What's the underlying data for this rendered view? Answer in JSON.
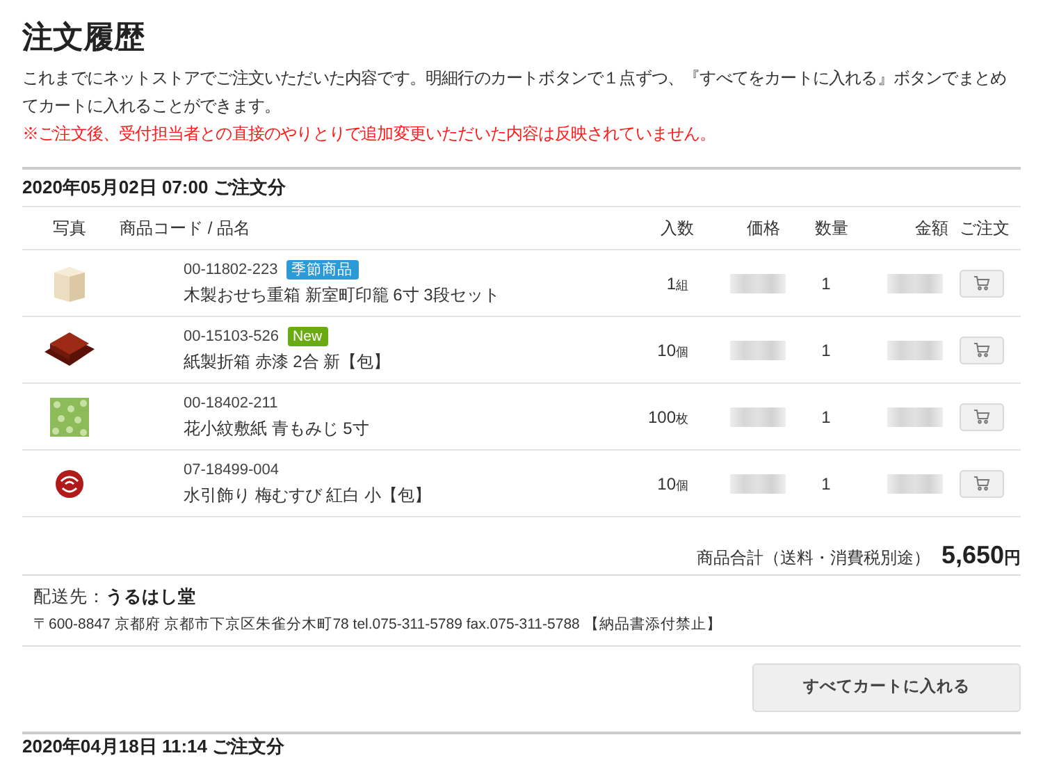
{
  "title": "注文履歴",
  "description": "これまでにネットストアでご注文いただいた内容です。明細行のカートボタンで１点ずつ、『すべてをカートに入れる』ボタンでまとめてカートに入れることができます。",
  "notice": "※ご注文後、受付担当者との直接のやりとりで追加変更いただいた内容は反映されていません。",
  "orders": [
    {
      "date": "2020年05月02日 07:00 ご注文分",
      "columns": [
        "写真",
        "商品コード / 品名",
        "入数",
        "価格",
        "数量",
        "金額",
        "ご注文"
      ],
      "items": [
        {
          "kind": "wood-box",
          "code": "00-11802-223",
          "badge": {
            "label": "季節商品",
            "color": "#2d9ad8"
          },
          "name": "木製おせち重箱 新室町印籠 6寸 3段セット",
          "count": "1",
          "unit": "組",
          "quantity": "1"
        },
        {
          "kind": "lacquer-box",
          "code": "00-15103-526",
          "badge": {
            "label": "New",
            "color": "#6aaa12"
          },
          "name": "紙製折箱 赤漆 2合 新【包】",
          "count": "10",
          "unit": "個",
          "quantity": "1"
        },
        {
          "kind": "paper-sheet",
          "code": "00-18402-211",
          "name": "花小紋敷紙 青もみじ 5寸",
          "count": "100",
          "unit": "枚",
          "quantity": "1"
        },
        {
          "kind": "knot",
          "code": "07-18499-004",
          "name": "水引飾り 梅むすび 紅白 小【包】",
          "count": "10",
          "unit": "個",
          "quantity": "1"
        }
      ],
      "total_label": "商品合計（送料・消費税別途）",
      "total_value": "5,650",
      "total_unit": "円",
      "shipping_label": "配送先：",
      "shipping_name": "うるはし堂",
      "address": "〒600-8847 京都府 京都市下京区朱雀分木町78 tel.075-311-5789 fax.075-311-5788 【納品書添付禁止】",
      "add_all_button": "すべてカートに入れる"
    },
    {
      "date": "2020年04月18日 11:14 ご注文分"
    }
  ]
}
